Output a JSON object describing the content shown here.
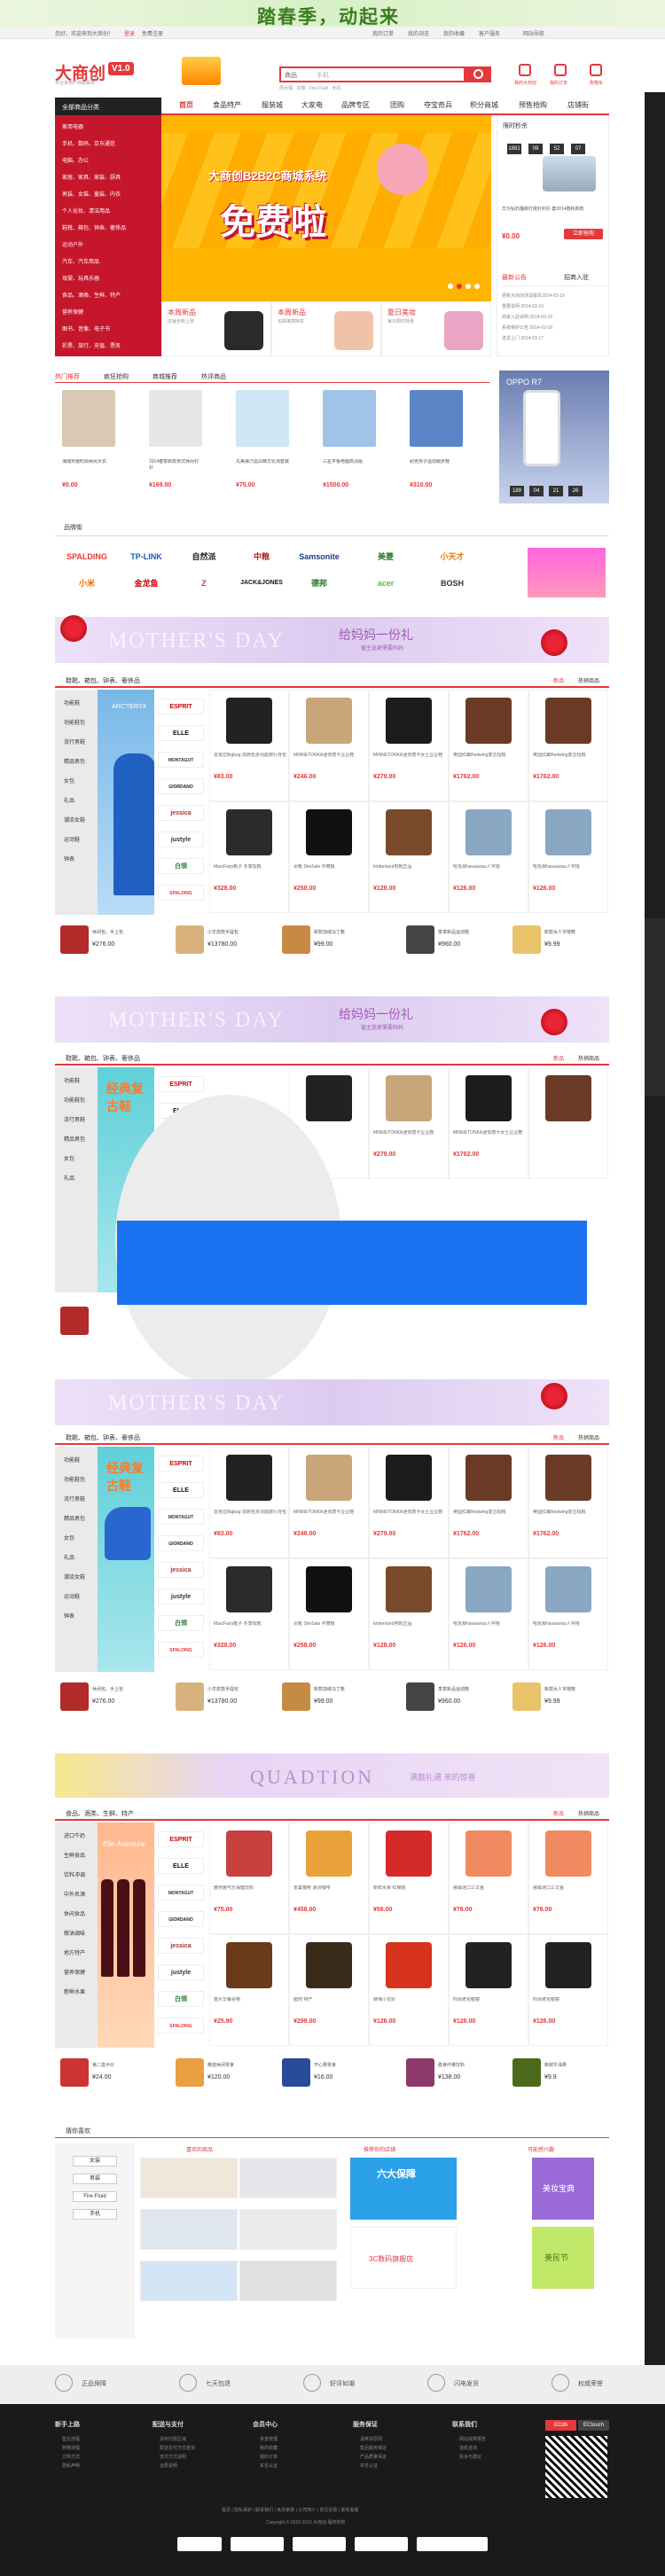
{
  "top_ad": {
    "text": "踏春季，动起来"
  },
  "topbar": {
    "links": [
      "您好，欢迎来到大商创！",
      "登录",
      "免费注册",
      "我的订单",
      "我的浏览",
      "我的收藏",
      "客户服务",
      "网站导航"
    ]
  },
  "header": {
    "logo": "大商创",
    "version": "V1.0",
    "slogan": "专业多用户商城系统",
    "search_scope": "商品",
    "search_placeholder": "手机",
    "hot_words": "周大福 · 衣服 · Fire·Fluid · 手机",
    "icons": [
      {
        "label": "我的大商创",
        "icon": "user-icon"
      },
      {
        "label": "我的订单",
        "icon": "order-icon"
      },
      {
        "label": "购物车",
        "icon": "cart-icon"
      }
    ]
  },
  "nav": {
    "all_categories": "全部商品分类",
    "items": [
      "首页",
      "食品特产",
      "服装城",
      "大家电",
      "品牌专区",
      "团购",
      "夺宝奇兵",
      "积分商城",
      "预售抢购",
      "店铺街"
    ],
    "active_index": 0
  },
  "categories": [
    "家用电器",
    "手机、数码、京东通信",
    "电脑、办公",
    "家居、家具、家装、厨具",
    "男装、女装、童装、内衣",
    "个人化妆、清洁用品",
    "鞋靴、箱包、钟表、奢侈品",
    "运动户外",
    "汽车、汽车用品",
    "母婴、玩具乐器",
    "食品、酒类、生鲜、特产",
    "营养保健",
    "图书、音像、电子书",
    "彩票、旅行、充值、票务"
  ],
  "banner": {
    "line1": "大商创B2B2C商城系统",
    "line2": "免费啦",
    "dots": 4
  },
  "promos": [
    {
      "title": "本周新品",
      "sub": "店铺全新上架",
      "color": "#f2e6d0"
    },
    {
      "title": "本周新品",
      "sub": "包邮美丽换季",
      "color": "#dde8f2"
    },
    {
      "title": "夏日美妆",
      "sub": "每日限时特惠",
      "color": "#f4d6e2"
    }
  ],
  "flash": {
    "title": "限时秒杀",
    "countdown": [
      "1881",
      "09",
      "52",
      "07"
    ],
    "item_title": "华为钻石猫柳打底针织衫 套2014春秋新款",
    "price": "¥0.00",
    "button": "立即抢购",
    "news_title": "最新公告",
    "news_more": "招商入驻",
    "news": [
      "更新大商创测试版本2014-03-19",
      "重要说明 2014-03-19",
      "商家入驻说明 2014-03-18",
      "系统维护公告 2014-03-18",
      "送货上门 2014-03-17"
    ]
  },
  "hot_tabs": [
    "热门推荐",
    "疯狂抢购",
    "商城推荐",
    "热评商品"
  ],
  "hot_items": [
    {
      "title": "海瑞男装时尚休闲大衣",
      "price": "¥0.00",
      "color": "#d9c9b2"
    },
    {
      "title": "2014春季新款男式休闲衬衫",
      "price": "¥169.00",
      "color": "#e6e6e6"
    },
    {
      "title": "丸美弹力蛋白精华乳液套装",
      "price": "¥75.00",
      "color": "#cfe6f4"
    },
    {
      "title": "三星平板电脑高清版",
      "price": "¥1500.00",
      "color": "#9fc4e8"
    },
    {
      "title": "耐克男子运动跑步鞋",
      "price": "¥310.00",
      "color": "#5a86c8"
    }
  ],
  "oppo": {
    "title": "OPPO R7",
    "countdown": [
      "189",
      "04",
      "21",
      "26"
    ]
  },
  "brands_title": "品牌街",
  "brands": [
    "SPALDING",
    "TP-LINK",
    "自然派",
    "中粮",
    "Samsonite",
    "美菱",
    "小天才",
    "小米",
    "金龙鱼",
    "Z",
    "JACK&JONES",
    "德邦",
    "acer",
    "BOSH"
  ],
  "mothers_day": {
    "big": "MOTHER'S DAY",
    "cn": "给妈妈一份礼",
    "sub": "窗主选更需要妈妈"
  },
  "floor_1": {
    "title": "鞋靴、箱包、钟表、奢侈品",
    "tabs": [
      "新品",
      "热销商品"
    ],
    "side_cats": [
      "功能鞋",
      "功能鞋包",
      "流行男鞋",
      "精品男包",
      "女包",
      "礼品",
      "潮流女鞋",
      "运动鞋",
      "钟表"
    ],
    "side_brands": [
      "ESPRIT",
      "ELLE",
      "MONTAGUT",
      "GIORDANO",
      "jessica",
      "justyle",
      "白领",
      "SPALDING"
    ],
    "pic_label": "ARC'TERYX"
  },
  "goods_row": [
    {
      "title": "雷克拉Bigbag 双肩包多功能旅行背包",
      "price": "¥83.00",
      "color": "#222"
    },
    {
      "title": "MINNETONKA迷你唐卡豆豆鞋",
      "price": "¥246.00",
      "color": "#c9a57a"
    },
    {
      "title": "MINNETONKA迷你唐卡女士豆豆鞋",
      "price": "¥279.00",
      "color": "#1c1c1c"
    },
    {
      "title": "英国红翼Redwing复古短靴",
      "price": "¥1762.00",
      "color": "#6a3a24"
    },
    {
      "title": "MarcFairy靴子 冬季短靴",
      "price": "¥328.00",
      "color": "#2b2b2b"
    },
    {
      "title": "女靴 SheSale 中筒靴",
      "price": "¥258.00",
      "color": "#111"
    },
    {
      "title": "timberland男靴正品",
      "price": "¥128.00",
      "color": "#7a4a2c"
    },
    {
      "title": "哈瓦那havaianas人字拖",
      "price": "¥126.00",
      "color": "#8aa7c4"
    }
  ],
  "bottom_row": [
    {
      "title": "休闲包、手上包",
      "price": "¥276.00",
      "color": "#b22a2a"
    },
    {
      "title": "小羊皮款手提包",
      "price": "¥13780.00",
      "color": "#d8b27d"
    },
    {
      "title": "新款加绒马丁靴",
      "price": "¥99.00",
      "color": "#c68a44"
    },
    {
      "title": "季季新品运动鞋",
      "price": "¥960.00",
      "color": "#444"
    },
    {
      "title": "新款女人字拖鞋",
      "price": "¥9.99",
      "color": "#e9c36a"
    }
  ],
  "floor_3_pic": "经典复古鞋",
  "quadtion": {
    "text": "QUADTION",
    "cn": "满额礼遇 来的惊喜"
  },
  "floor_food": {
    "title": "食品、酒类、生鲜、特产",
    "tabs": [
      "新品",
      "热销商品"
    ],
    "side_cats": [
      "进口牛奶",
      "生鲜食品",
      "饮料冲调",
      "中外名酒",
      "休闲食品",
      "粮油调味",
      "地方特产",
      "营养保健",
      "新鲜水果"
    ],
    "pic_label": "Elle Aventure",
    "goods": [
      {
        "title": "雅培雅可乐保健饮料",
        "price": "¥75.00",
        "color": "#c84040"
      },
      {
        "title": "雀巢咖啡 速溶咖啡",
        "price": "¥458.00",
        "color": "#e9a23a"
      },
      {
        "title": "新鲜水果 红樱桃",
        "price": "¥56.00",
        "color": "#d42a2a"
      },
      {
        "title": "挪威进口三文鱼",
        "price": "¥76.00",
        "color": "#f08a60"
      },
      {
        "title": "麦片早餐谷物",
        "price": "¥25.90",
        "color": "#6a3a1a"
      },
      {
        "title": "腊肉 特产",
        "price": "¥299.00",
        "color": "#3a2a1a"
      },
      {
        "title": "麻辣小龙虾",
        "price": "¥126.00",
        "color": "#d6341c"
      },
      {
        "title": "时尚老花眼镜",
        "price": "¥126.00",
        "color": "#222"
      }
    ],
    "bottom": [
      {
        "title": "第二盒半价",
        "price": "¥24.00",
        "color": "#c33"
      },
      {
        "title": "精选休闲零食",
        "price": "¥120.00",
        "color": "#e8a040"
      },
      {
        "title": "开心果零食",
        "price": "¥16.00",
        "color": "#2a4a9a"
      },
      {
        "title": "膳食纤维饮料",
        "price": "¥138.00",
        "color": "#8b3a6a"
      },
      {
        "title": "新鲜牛油果",
        "price": "¥9.9",
        "color": "#4a6a1a"
      }
    ]
  },
  "like": {
    "title": "猜你喜欢",
    "filters": [
      "女装",
      "男装",
      "Fire·Fluid",
      "手机"
    ],
    "col_titles": [
      "喜欢的商品",
      "推荐你的店铺",
      "可能感兴趣"
    ],
    "shop_ads": [
      "六大保障",
      "3C数码旗舰店",
      "美妆宝典",
      "美民节"
    ]
  },
  "guarantees": [
    "正品保障",
    "七天包退",
    "好评如潮",
    "闪电发货",
    "权威荣誉"
  ],
  "footer": {
    "cols": [
      {
        "title": "新手上路",
        "items": [
          "售后流程",
          "购物流程",
          "订购方式",
          "隐私声明"
        ]
      },
      {
        "title": "配送与支付",
        "items": [
          "货到付款区域",
          "配送支付方式查询",
          "支付方式说明",
          "运费说明"
        ]
      },
      {
        "title": "会员中心",
        "items": [
          "资金管理",
          "我的收藏",
          "我的订单",
          "实名认证"
        ]
      },
      {
        "title": "服务保证",
        "items": [
          "退换货原则",
          "售后服务保证",
          "产品质量保证",
          "实名认证"
        ]
      },
      {
        "title": "联系我们",
        "items": [
          "网站故障报告",
          "选机咨询",
          "投诉与建议"
        ]
      }
    ],
    "qr_tabs": [
      "ECdb",
      "ECtouch"
    ],
    "links": "首页 | 隐私保护 | 联系我们 | 免责条款 | 公司简介 | 意见反馈 | 联系客服",
    "copyright": "Copyright © 2015-2016 大商创 版权所有"
  }
}
